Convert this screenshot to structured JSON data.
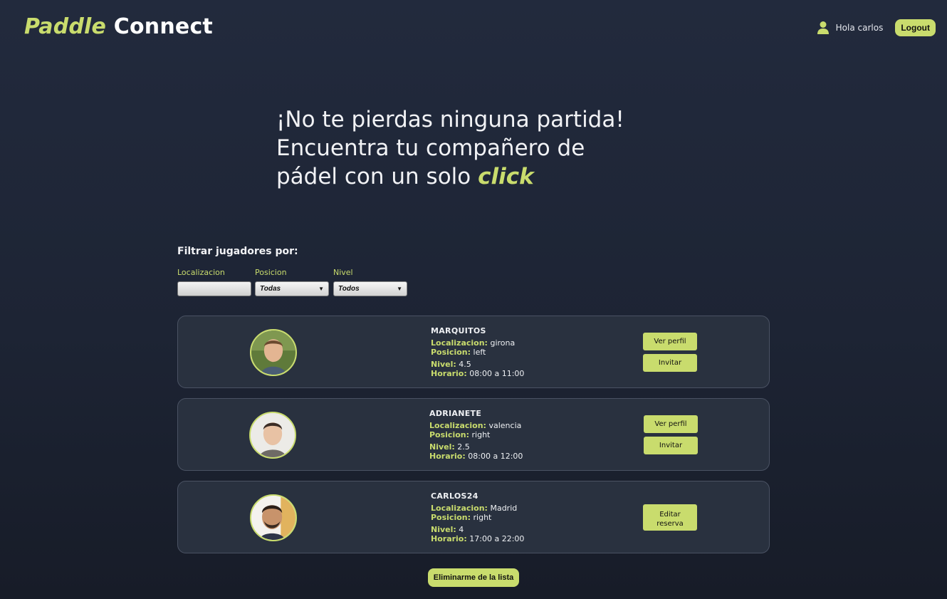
{
  "brand": {
    "part1": "Paddle",
    "part2": "Connect"
  },
  "header": {
    "greeting": "Hola carlos",
    "logout_label": "Logout",
    "user_icon": "user-icon"
  },
  "hero": {
    "line1": "¡No te pierdas ninguna partida!",
    "line2": "Encuentra tu compañero de",
    "line3": "pádel con un solo",
    "highlight": "click"
  },
  "filters": {
    "title": "Filtrar jugadores por:",
    "location_label": "Localizacion",
    "location_value": "",
    "position_label": "Posicion",
    "position_value": "Todas",
    "level_label": "Nivel",
    "level_value": "Todos"
  },
  "labels": {
    "location": "Localizacion:",
    "position": "Posicion:",
    "level": "Nivel:",
    "schedule": "Horario:"
  },
  "players": [
    {
      "name": "MARQUITOS",
      "location": "girona",
      "position": "left",
      "level": "4.5",
      "schedule": "08:00 a 11:00",
      "btn_profile": "Ver perfil",
      "btn_invite": "Invitar"
    },
    {
      "name": "ADRIANETE",
      "location": "valencia",
      "position": "right",
      "level": "2.5",
      "schedule": "08:00 a 12:00",
      "btn_profile": "Ver perfil",
      "btn_invite": "Invitar"
    },
    {
      "name": "CARLOS24",
      "location": "Madrid",
      "position": "right",
      "level": "4",
      "schedule": "17:00 a 22:00",
      "btn_edit_1": "Editar",
      "btn_edit_2": "reserva"
    }
  ],
  "leave_label": "Eliminarme de la lista",
  "colors": {
    "accent": "#c9dc6d",
    "background": "#1f2636",
    "card": "#29313f"
  }
}
